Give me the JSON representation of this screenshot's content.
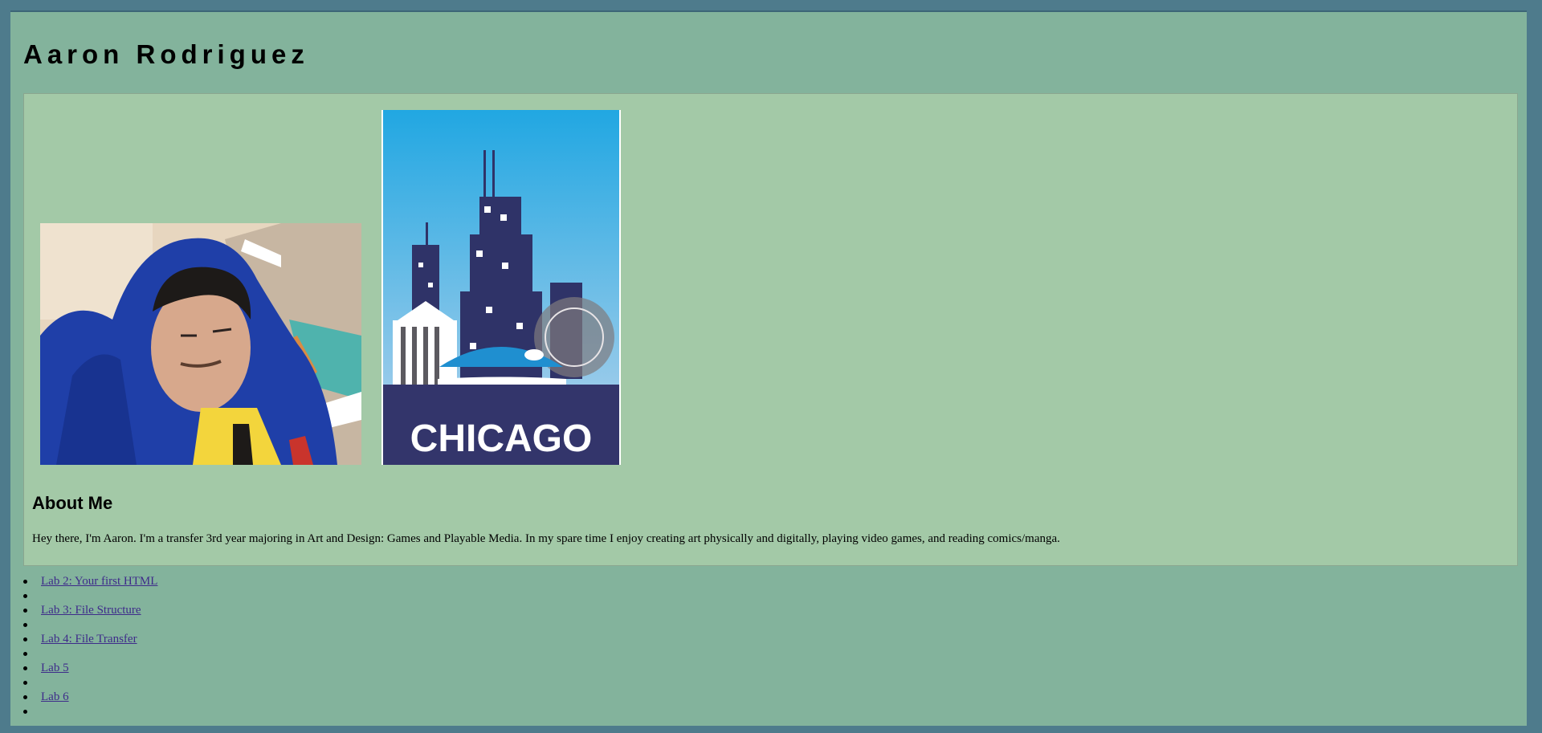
{
  "header": {
    "title": "Aaron Rodriguez"
  },
  "images": {
    "portrait": {
      "alt": "Photo of Aaron in a blue hoodie"
    },
    "poster": {
      "text": "CHICAGO"
    }
  },
  "about": {
    "heading": "About Me",
    "text": "Hey there, I'm Aaron. I'm a transfer 3rd year majoring in Art and Design: Games and Playable Media. In my spare time I enjoy creating art physically and digitally, playing video games, and reading comics/manga."
  },
  "nav": {
    "links": [
      {
        "label": "Lab 2: Your first HTML"
      },
      {
        "label": "Lab 3: File Structure"
      },
      {
        "label": "Lab 4: File Transfer"
      },
      {
        "label": "Lab 5"
      },
      {
        "label": "Lab 6"
      }
    ]
  },
  "colors": {
    "page_bg": "#4e7b8c",
    "outer_bg": "#83b39c",
    "content_bg": "#a3c9a7",
    "link": "#3e2b8a"
  }
}
